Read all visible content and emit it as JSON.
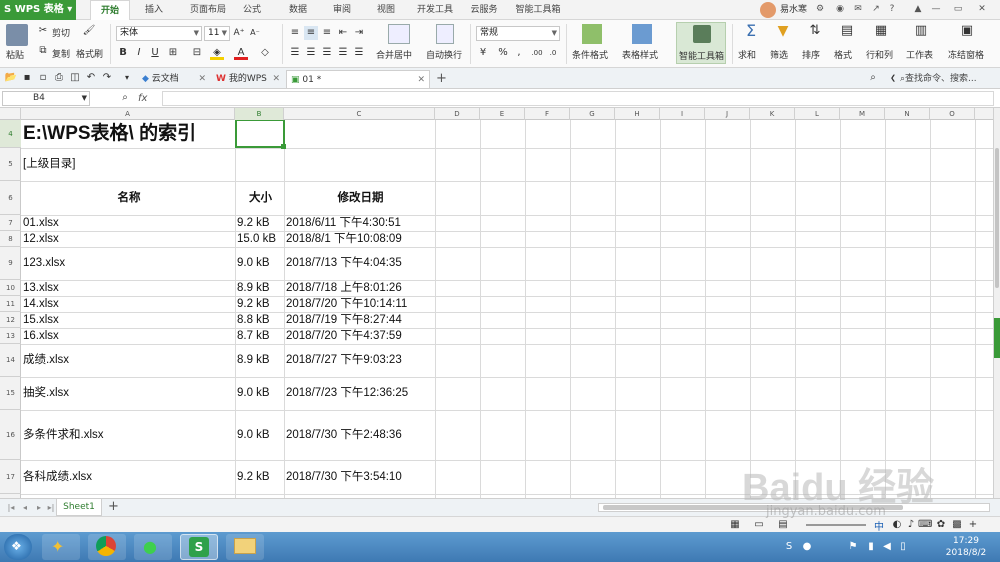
{
  "app": {
    "title": "WPS 表格"
  },
  "menu": {
    "tabs": [
      "开始",
      "插入",
      "页面布局",
      "公式",
      "数据",
      "审阅",
      "视图",
      "开发工具",
      "云服务",
      "智能工具箱"
    ],
    "active_index": 0,
    "user_name": "易水寒",
    "icons": {
      "minimize": "—",
      "restore": "▭",
      "close": "✕",
      "help": "?"
    }
  },
  "ribbon": {
    "paste": "粘贴",
    "cut": "剪切",
    "copy": "复制",
    "format_painter": "格式刷",
    "font_name": "宋体",
    "font_size": "11",
    "bold": "B",
    "italic": "I",
    "underline": "U",
    "merge_center": "合并居中",
    "wrap_text": "自动换行",
    "number_format": "常规",
    "percent": "%",
    "thousands": ",",
    "cond_format": "条件格式",
    "table_style": "表格样式",
    "smart_toolbox": "智能工具箱",
    "sum": "求和",
    "filter": "筛选",
    "sort": "排序",
    "format": "格式",
    "row_col": "行和列",
    "worksheet": "工作表",
    "freeze": "冻结窗格",
    "font_color_hex": "#e02020",
    "fill_color_hex": "#f5d000"
  },
  "docbar": {
    "tabs": [
      {
        "label": "云文档",
        "closable": true
      },
      {
        "label": "我的WPS",
        "closable": true
      },
      {
        "label": "01 *",
        "closable": true
      }
    ],
    "active_index": 2,
    "add": "+",
    "search_placeholder": "查找命令、搜索..."
  },
  "formula_bar": {
    "name_box": "B4",
    "fx": "fx",
    "content": ""
  },
  "columns": [
    "A",
    "B",
    "C",
    "D",
    "E",
    "F",
    "G",
    "H",
    "I",
    "J",
    "K",
    "L",
    "M",
    "N",
    "O"
  ],
  "rows": [
    {
      "num": "4",
      "a": "E:\\WPS表格\\ 的索引",
      "b": "",
      "c": ""
    },
    {
      "num": "5",
      "a": "[上级目录]",
      "b": "",
      "c": ""
    },
    {
      "num": "6",
      "a": "名称",
      "b": "大小",
      "c": "修改日期"
    },
    {
      "num": "7",
      "a": "01.xlsx",
      "b": "9.2 kB",
      "c": "2018/6/11 下午4:30:51"
    },
    {
      "num": "8",
      "a": "12.xlsx",
      "b": "15.0 kB",
      "c": "2018/8/1 下午10:08:09"
    },
    {
      "num": "9",
      "a": "123.xlsx",
      "b": "9.0 kB",
      "c": "2018/7/13 下午4:04:35"
    },
    {
      "num": "10",
      "a": "13.xlsx",
      "b": "8.9 kB",
      "c": "2018/7/18 上午8:01:26"
    },
    {
      "num": "11",
      "a": "14.xlsx",
      "b": "9.2 kB",
      "c": "2018/7/20 下午10:14:11"
    },
    {
      "num": "12",
      "a": "15.xlsx",
      "b": "8.8 kB",
      "c": "2018/7/19 下午8:27:44"
    },
    {
      "num": "13",
      "a": "16.xlsx",
      "b": "8.7 kB",
      "c": "2018/7/20 下午4:37:59"
    },
    {
      "num": "14",
      "a": "成绩.xlsx",
      "b": "8.9 kB",
      "c": "2018/7/27 下午9:03:23"
    },
    {
      "num": "15",
      "a": "抽奖.xlsx",
      "b": "9.0 kB",
      "c": "2018/7/23 下午12:36:25"
    },
    {
      "num": "16",
      "a": "多条件求和.xlsx",
      "b": "9.0 kB",
      "c": "2018/7/30 下午2:48:36"
    },
    {
      "num": "17",
      "a": "各科成绩.xlsx",
      "b": "9.2 kB",
      "c": "2018/7/30 下午3:54:10"
    }
  ],
  "sheetbar": {
    "sheet": "Sheet1",
    "add": "+"
  },
  "statusbar": {
    "zoom_label": "中"
  },
  "taskbar": {
    "time": "17:29",
    "date": "2018/8/2"
  },
  "watermark": {
    "text": "Baidu 经验",
    "sub": "jingyan.baidu.com"
  }
}
